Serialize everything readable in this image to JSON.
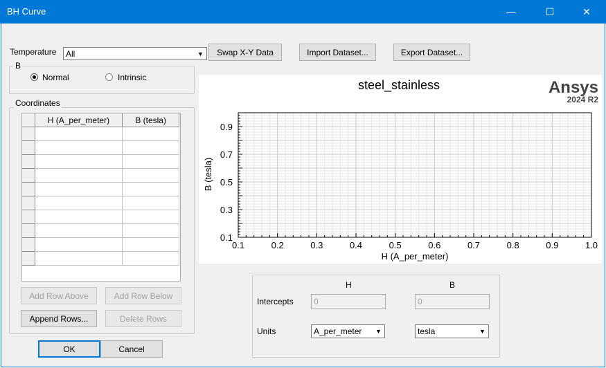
{
  "window": {
    "title": "BH Curve",
    "minimize_glyph": "—",
    "maximize_glyph": "☐",
    "close_glyph": "✕"
  },
  "temperature": {
    "label": "Temperature",
    "value": "All"
  },
  "toolbar": {
    "swap_label": "Swap X-Y Data",
    "import_label": "Import Dataset...",
    "export_label": "Export Dataset..."
  },
  "b_group": {
    "label": "B",
    "normal_label": "Normal",
    "intrinsic_label": "Intrinsic",
    "selected": "Normal"
  },
  "coordinates": {
    "label": "Coordinates",
    "columns": [
      "H (A_per_meter)",
      "B (tesla)"
    ],
    "row_count": 10,
    "add_above_label": "Add Row Above",
    "add_below_label": "Add Row Below",
    "append_label": "Append Rows...",
    "delete_label": "Delete Rows"
  },
  "chart_data": {
    "type": "line",
    "title": "steel_stainless",
    "brand": "Ansys",
    "version": "2024 R2",
    "xlabel": "H (A_per_meter)",
    "ylabel": "B (tesla)",
    "xlim": [
      0.1,
      1.0
    ],
    "ylim": [
      0.1,
      1.0
    ],
    "xticks": [
      0.1,
      0.2,
      0.3,
      0.4,
      0.5,
      0.6,
      0.7,
      0.8,
      0.9,
      1.0
    ],
    "yticks": [
      0.1,
      0.3,
      0.5,
      0.7,
      0.9
    ],
    "grid": true,
    "series": []
  },
  "intercepts": {
    "h_header": "H",
    "b_header": "B",
    "intercepts_label": "Intercepts",
    "h_value": "0",
    "b_value": "0",
    "units_label": "Units",
    "h_unit": "A_per_meter",
    "b_unit": "tesla"
  },
  "dialog": {
    "ok_label": "OK",
    "cancel_label": "Cancel"
  }
}
